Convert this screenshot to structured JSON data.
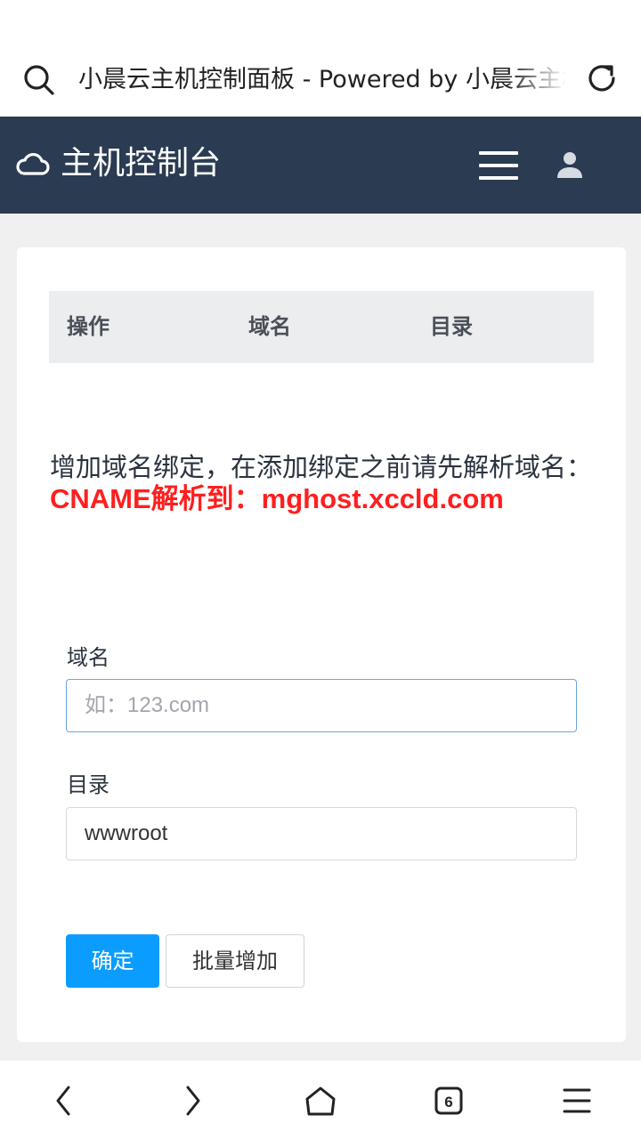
{
  "browser": {
    "page_title": "小晨云主机控制面板 - Powered by 小晨云主机",
    "tab_count": "6"
  },
  "header": {
    "title": "主机控制台"
  },
  "table": {
    "columns": [
      "操作",
      "域名",
      "目录"
    ]
  },
  "notice": {
    "text": "增加域名绑定，在添加绑定之前请先解析域名：",
    "highlight": "CNAME解析到：mghost.xccld.com"
  },
  "form": {
    "domain_label": "域名",
    "domain_placeholder": "如：123.com",
    "domain_value": "",
    "dir_label": "目录",
    "dir_value": "wwwroot",
    "submit_label": "确定",
    "batch_label": "批量增加"
  },
  "colors": {
    "header_bg": "#2a3b52",
    "primary": "#0a9dff",
    "highlight": "#ff1f1f"
  },
  "icons": {
    "address_search": "search-icon",
    "address_reload": "reload-icon",
    "brand": "cloud-icon",
    "menu": "hamburger-menu-icon",
    "user": "user-icon",
    "nav_back": "chevron-left-icon",
    "nav_forward": "chevron-right-icon",
    "nav_home": "home-icon",
    "nav_tabs": "tabs-icon",
    "nav_menu": "menu-icon"
  }
}
